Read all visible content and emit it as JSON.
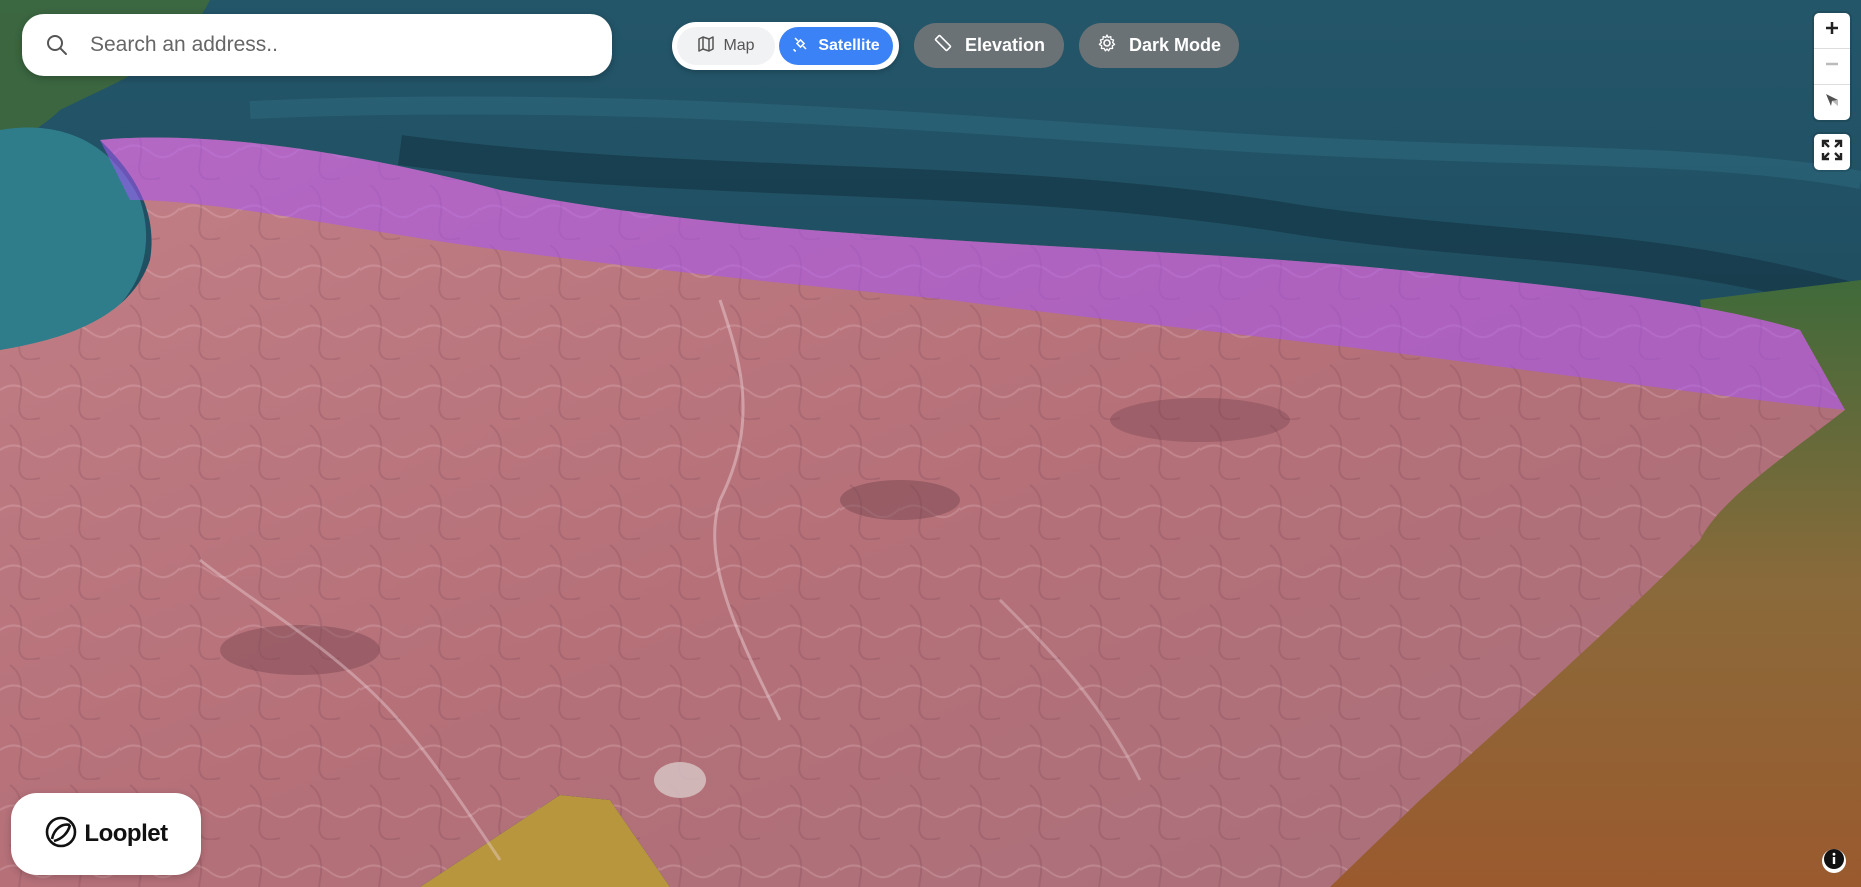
{
  "search": {
    "placeholder": "Search an address..",
    "value": ""
  },
  "view_toggle": {
    "map_label": "Map",
    "satellite_label": "Satellite",
    "active": "satellite"
  },
  "toolbar": {
    "elevation_label": "Elevation",
    "dark_mode_label": "Dark Mode"
  },
  "map_controls": {
    "zoom_in": "+",
    "zoom_out": "−",
    "compass_icon": "compass-icon",
    "fullscreen_icon": "fullscreen-icon"
  },
  "branding": {
    "logo_text": "Looplet"
  },
  "attribution": {
    "icon": "info-icon"
  },
  "colors": {
    "ocean": "#1f4d5c",
    "highlight_overlay": "#a855f7",
    "accent": "#3b82f6",
    "pill_bg": "#787878"
  }
}
